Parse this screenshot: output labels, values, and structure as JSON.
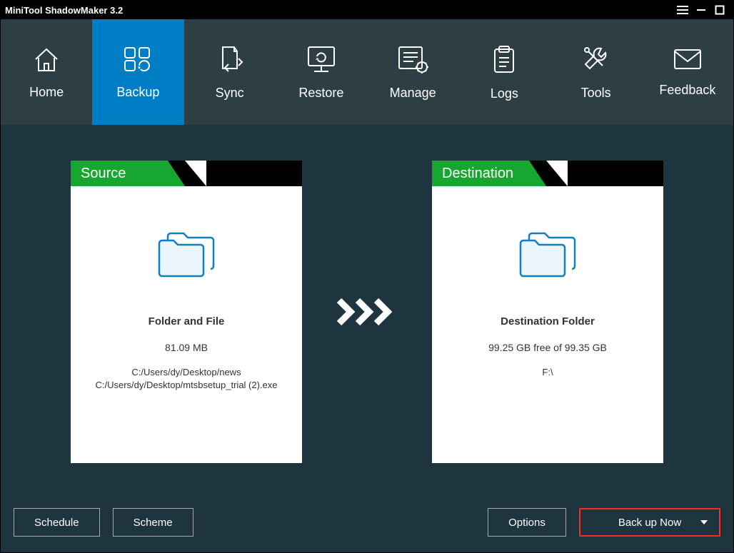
{
  "titlebar": {
    "title": "MiniTool ShadowMaker 3.2"
  },
  "nav": {
    "home": "Home",
    "backup": "Backup",
    "sync": "Sync",
    "restore": "Restore",
    "manage": "Manage",
    "logs": "Logs",
    "tools": "Tools",
    "feedback": "Feedback"
  },
  "source": {
    "header": "Source",
    "title": "Folder and File",
    "size": "81.09 MB",
    "path1": "C:/Users/dy/Desktop/news",
    "path2": "C:/Users/dy/Desktop/mtsbsetup_trial (2).exe"
  },
  "destination": {
    "header": "Destination",
    "title": "Destination Folder",
    "free": "99.25 GB free of 99.35 GB",
    "path": "F:\\"
  },
  "buttons": {
    "schedule": "Schedule",
    "scheme": "Scheme",
    "options": "Options",
    "backupNow": "Back up Now"
  }
}
